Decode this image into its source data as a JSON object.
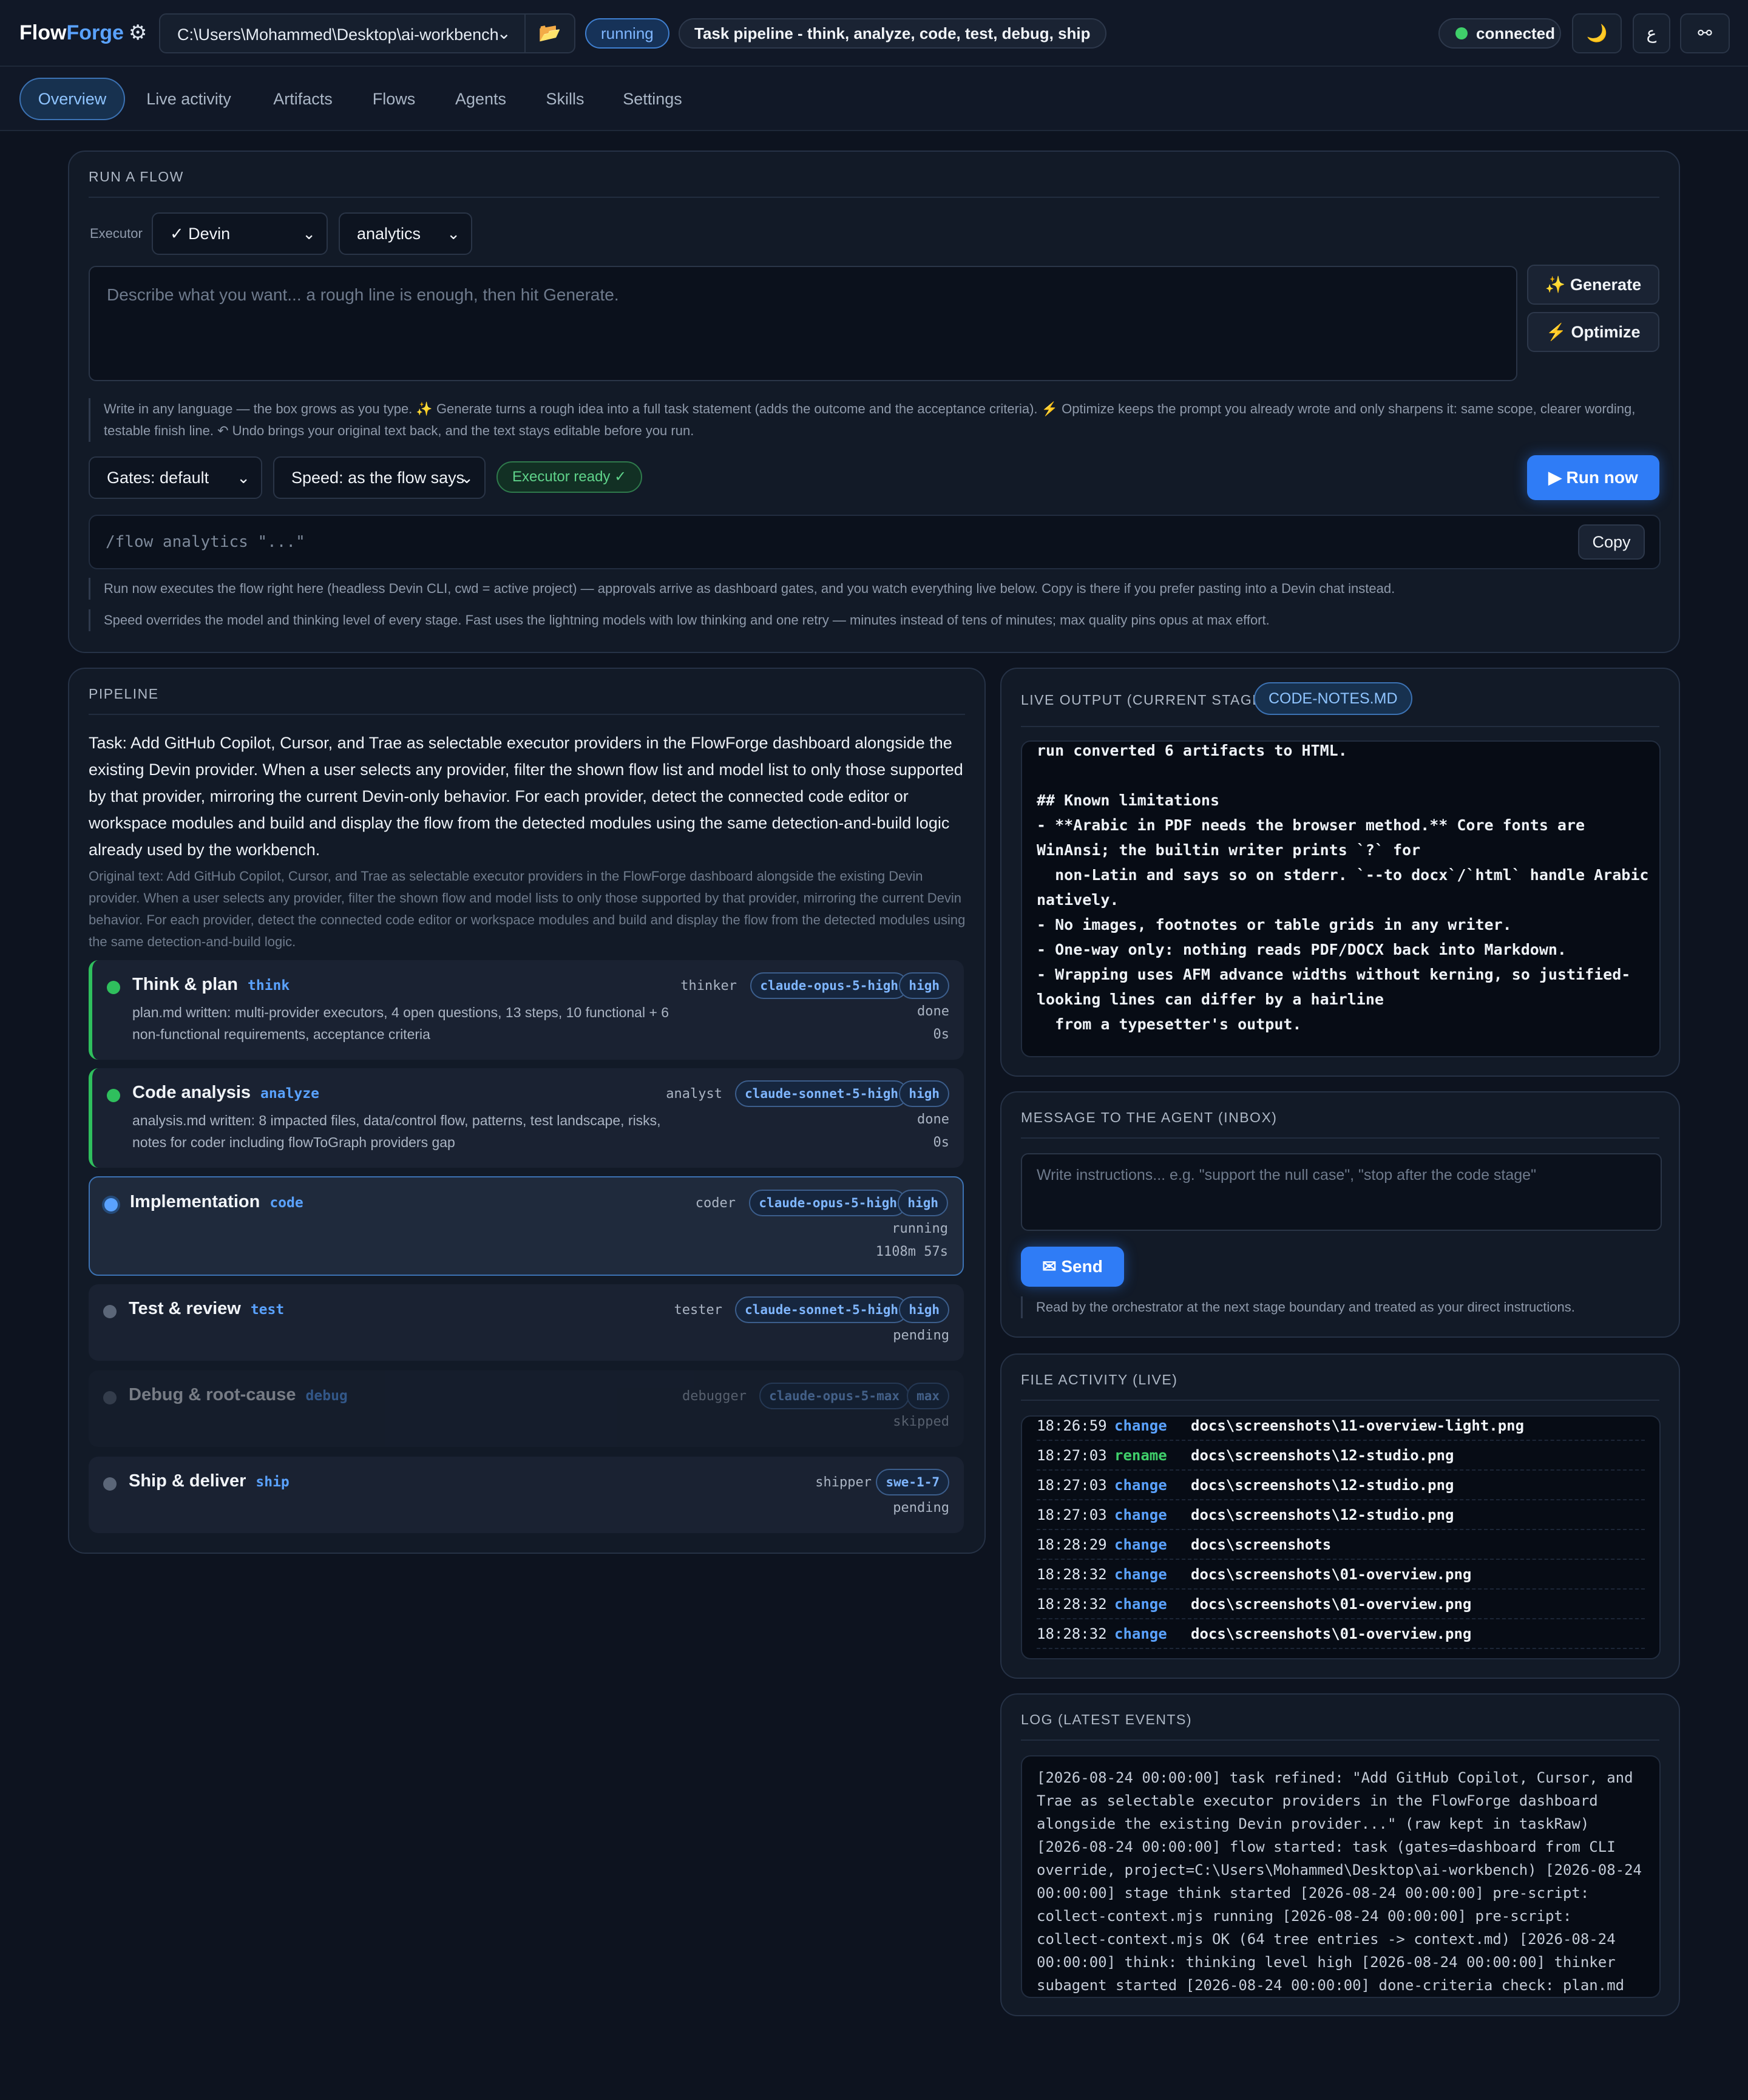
{
  "app": {
    "brand_flow": "Flow",
    "brand_forge": "Forge",
    "gear_glyph": "⚙",
    "project_path": "C:\\Users\\Mohammed\\Desktop\\ai-workbench",
    "status": "running",
    "task_summary": "Task pipeline - think, analyze, code, test, debug, ship",
    "connection": "connected",
    "theme_glyph": "🌙",
    "lang_glyph": "ع",
    "link_glyph": "⚯"
  },
  "tabs": [
    "Overview",
    "Live activity",
    "Artifacts",
    "Flows",
    "Agents",
    "Skills",
    "Settings"
  ],
  "run_flow": {
    "title": "RUN A FLOW",
    "executor_label": "Executor",
    "executor_value": "✓ Devin",
    "flow_value": "analytics",
    "prompt_placeholder": "Describe what you want... a rough line is enough, then hit Generate.",
    "generate_label": "✨ Generate",
    "optimize_label": "⚡ Optimize",
    "hint_1": "Write in any language — the box grows as you type. ✨ Generate turns a rough idea into a full task statement (adds the outcome and the acceptance criteria). ⚡ Optimize keeps the prompt you already wrote and only sharpens it: same scope, clearer wording, testable finish line. ↶ Undo brings your original text back, and the text stays editable before you run.",
    "gates_value": "Gates: default",
    "speed_value": "Speed: as the flow says",
    "executor_ready": "Executor ready ✓",
    "run_now_label": "▶ Run now",
    "command": "/flow analytics \"...\"",
    "copy_label": "Copy",
    "hint_2": "Run now executes the flow right here (headless Devin CLI, cwd = active project) — approvals arrive as dashboard gates, and you watch everything live below. Copy is there if you prefer pasting into a Devin chat instead.",
    "hint_3": "Speed overrides the model and thinking level of every stage. Fast uses the lightning models with low thinking and one retry — minutes instead of tens of minutes; max quality pins opus at max effort."
  },
  "pipeline": {
    "title": "PIPELINE",
    "task": "Task: Add GitHub Copilot, Cursor, and Trae as selectable executor providers in the FlowForge dashboard alongside the existing Devin provider. When a user selects any provider, filter the shown flow list and model list to only those supported by that provider, mirroring the current Devin-only behavior. For each provider, detect the connected code editor or workspace modules and build and display the flow from the detected modules using the same detection-and-build logic already used by the workbench.",
    "original": "Original text: Add GitHub Copilot, Cursor, and Trae as selectable executor providers in the FlowForge dashboard alongside the existing Devin provider. When a user selects any provider, filter the shown flow and model lists to only those supported by that provider, mirroring the current Devin behavior. For each provider, detect the connected code editor or workspace modules and build and display the flow from the detected modules using the same detection-and-build logic.",
    "stages": [
      {
        "name": "Think & plan",
        "key": "think",
        "role": "thinker",
        "model": "claude-opus-5-high",
        "effort": "high",
        "status": "done",
        "time": "0s",
        "desc": "plan.md written: multi-provider executors, 4 open questions, 13 steps, 10 functional + 6 non-functional requirements, acceptance criteria"
      },
      {
        "name": "Code analysis",
        "key": "analyze",
        "role": "analyst",
        "model": "claude-sonnet-5-high",
        "effort": "high",
        "status": "done",
        "time": "0s",
        "desc": "analysis.md written: 8 impacted files, data/control flow, patterns, test landscape, risks, notes for coder including flowToGraph providers gap"
      },
      {
        "name": "Implementation",
        "key": "code",
        "role": "coder",
        "model": "claude-opus-5-high",
        "effort": "high",
        "status": "running",
        "time": "1108m 57s",
        "desc": ""
      },
      {
        "name": "Test & review",
        "key": "test",
        "role": "tester",
        "model": "claude-sonnet-5-high",
        "effort": "high",
        "status": "pending",
        "time": "",
        "desc": ""
      },
      {
        "name": "Debug & root-cause",
        "key": "debug",
        "role": "debugger",
        "model": "claude-opus-5-max",
        "effort": "max",
        "status": "skipped",
        "time": "",
        "desc": ""
      },
      {
        "name": "Ship & deliver",
        "key": "ship",
        "role": "shipper",
        "model": "swe-1-7",
        "effort": "",
        "status": "pending",
        "time": "",
        "desc": ""
      }
    ]
  },
  "live_output": {
    "title": "LIVE OUTPUT (CURRENT STAGE)",
    "file": "CODE-NOTES.MD",
    "text": "run converted 6 artifacts to HTML.\n\n## Known limitations\n- **Arabic in PDF needs the browser method.** Core fonts are\nWinAnsi; the builtin writer prints `?` for\n  non-Latin and says so on stderr. `--to docx`/`html` handle Arabic\nnatively.\n- No images, footnotes or table grids in any writer.\n- One-way only: nothing reads PDF/DOCX back into Markdown.\n- Wrapping uses AFM advance widths without kerning, so justified-\nlooking lines can differ by a hairline\n  from a typesetter's output."
  },
  "inbox": {
    "title": "MESSAGE TO THE AGENT (INBOX)",
    "placeholder": "Write instructions... e.g. \"support the null case\", \"stop after the code stage\"",
    "send_label": "✉ Send",
    "hint": "Read by the orchestrator at the next stage boundary and treated as your direct instructions."
  },
  "file_activity": {
    "title": "FILE ACTIVITY (LIVE)",
    "rows": [
      {
        "time": "18:26:59",
        "kind": "change",
        "path": "docs\\screenshots\\11-overview-light.png"
      },
      {
        "time": "18:27:03",
        "kind": "rename",
        "path": "docs\\screenshots\\12-studio.png"
      },
      {
        "time": "18:27:03",
        "kind": "change",
        "path": "docs\\screenshots\\12-studio.png"
      },
      {
        "time": "18:27:03",
        "kind": "change",
        "path": "docs\\screenshots\\12-studio.png"
      },
      {
        "time": "18:28:29",
        "kind": "change",
        "path": "docs\\screenshots"
      },
      {
        "time": "18:28:32",
        "kind": "change",
        "path": "docs\\screenshots\\01-overview.png"
      },
      {
        "time": "18:28:32",
        "kind": "change",
        "path": "docs\\screenshots\\01-overview.png"
      },
      {
        "time": "18:28:32",
        "kind": "change",
        "path": "docs\\screenshots\\01-overview.png"
      }
    ],
    "colors": {
      "change": "#5aa2ff",
      "rename": "#3fcf6a"
    }
  },
  "log": {
    "title": "LOG (LATEST EVENTS)",
    "text": "[2026-08-24 00:00:00] task refined: \"Add GitHub Copilot, Cursor, and Trae as selectable executor providers in the FlowForge dashboard alongside the existing Devin provider...\" (raw kept in taskRaw) [2026-08-24 00:00:00] flow started: task (gates=dashboard from CLI override, project=C:\\Users\\Mohammed\\Desktop\\ai-workbench) [2026-08-24 00:00:00] stage think started [2026-08-24 00:00:00] pre-script: collect-context.mjs running [2026-08-24 00:00:00] pre-script: collect-context.mjs OK (64 tree entries -> context.md) [2026-08-24 00:00:00] think: thinking level high [2026-08-24 00:00:00] thinker subagent started [2026-08-24 00:00:00] done-criteria check: plan.md has all"
  },
  "colors": {
    "accent": "#2f7cf6",
    "done": "#2fbf5d",
    "running": "#5aa2ff",
    "pending": "#5b6678"
  }
}
